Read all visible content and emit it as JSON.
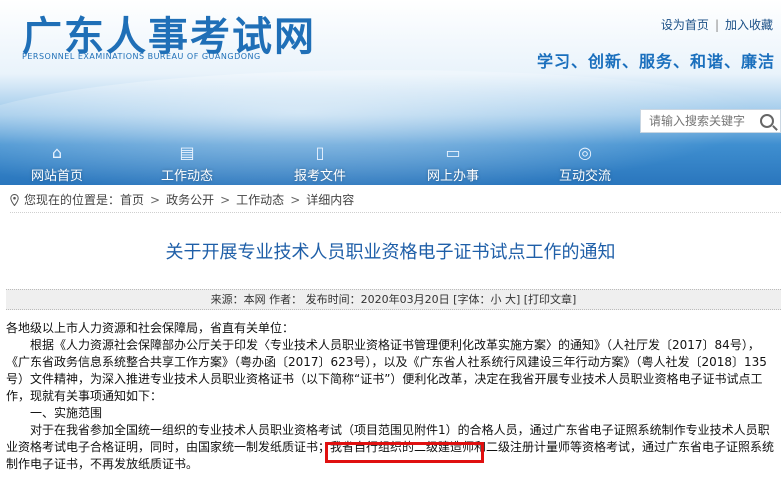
{
  "header": {
    "logo_title": "广东人事考试网",
    "logo_sub": "PERSONNEL EXAMINATIONS BUREAU OF GUANGDONG",
    "top_links": [
      "设为首页",
      "加入收藏"
    ],
    "slogan": "学习、创新、服务、和谐、廉洁",
    "search_placeholder": "请输入搜索关键字"
  },
  "nav": {
    "items": [
      {
        "label": "网站首页",
        "icon": "home-icon"
      },
      {
        "label": "工作动态",
        "icon": "news-icon"
      },
      {
        "label": "报考文件",
        "icon": "document-icon"
      },
      {
        "label": "网上办事",
        "icon": "online-service-icon"
      },
      {
        "label": "互动交流",
        "icon": "chat-icon"
      }
    ]
  },
  "breadcrumb": {
    "prefix": "您现在的位置是：",
    "items": [
      "首页",
      "政务公开",
      "工作动态",
      "详细内容"
    ]
  },
  "article": {
    "title": "关于开展专业技术人员职业资格电子证书试点工作的通知",
    "meta": {
      "source": "来源：本网",
      "author": "作者：",
      "date": "发布时间：2020年03月20日",
      "font": "[字体：小 大]",
      "print": "[打印文章]"
    },
    "paragraphs": [
      "各地级以上市人力资源和社会保障局，省直有关单位：",
      "根据《人力资源社会保障部办公厅关于印发〈专业技术人员职业资格证书管理便利化改革实施方案〉的通知》（人社厅发〔2017〕84号），《广东省政务信息系统整合共享工作方案》（粤办函〔2017〕623号），以及《广东省人社系统行风建设三年行动方案》（粤人社发〔2018〕135号）文件精神，为深入推进专业技术人员职业资格证书（以下简称“证书”）便利化改革，决定在我省开展专业技术人员职业资格电子证书试点工作，现就有关事项通知如下：",
      "一、实施范围",
      "对于在我省参加全国统一组织的专业技术人员职业资格考试（项目范围见附件1）的合格人员，通过广东省电子证照系统制作专业技术人员职业资格考试电子合格证明，同时，由国家统一制发纸质证书；我省自行组织的二级建造师和二级注册计量师等资格考试，通过广东省电子证照系统制作电子证书，不再发放纸质证书。"
    ]
  },
  "colors": {
    "brand_blue": "#1f6fb7",
    "title_blue": "#1f5fa8",
    "highlight_red": "#e01010"
  }
}
